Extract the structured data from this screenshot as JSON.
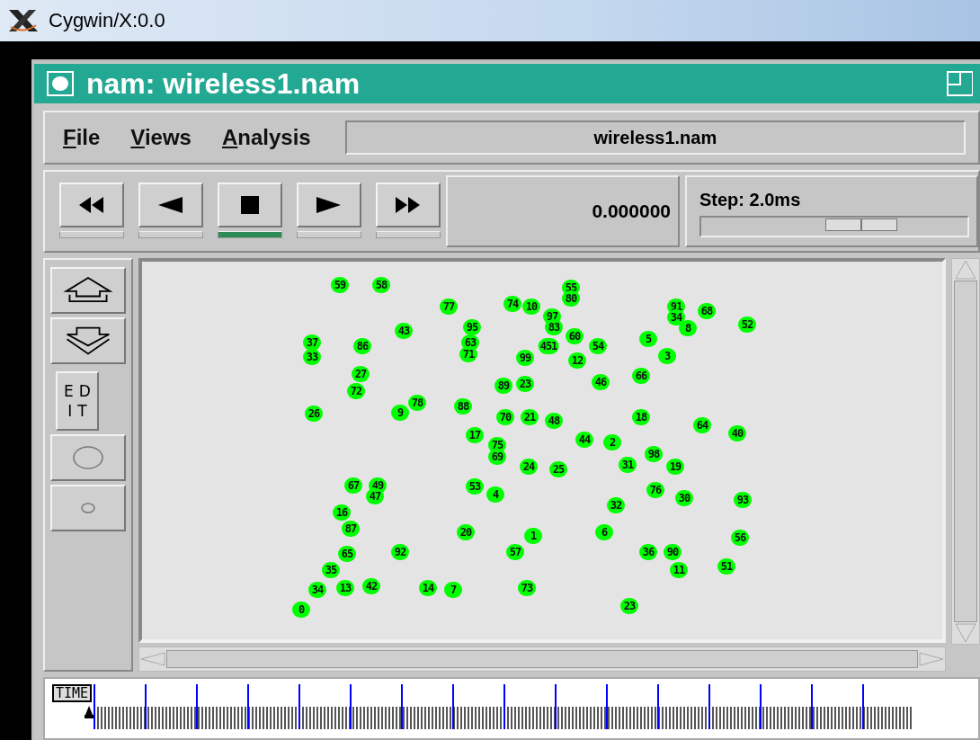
{
  "screen_title": "Cygwin/X:0.0",
  "window": {
    "title": "nam: wireless1.nam"
  },
  "menu": [
    {
      "label": "File"
    },
    {
      "label": "Views"
    },
    {
      "label": "Analysis"
    }
  ],
  "file_field": {
    "value": "wireless1.nam"
  },
  "playback_buttons": [
    {
      "kind": "rewind",
      "selected": false
    },
    {
      "kind": "back",
      "selected": false
    },
    {
      "kind": "stop",
      "selected": true
    },
    {
      "kind": "play",
      "selected": false
    },
    {
      "kind": "forward",
      "selected": false
    }
  ],
  "time": "0.000000",
  "step": {
    "label": "Step: 2.0ms",
    "level": 0.6
  },
  "tools": [
    {
      "kind": "zoom-in"
    },
    {
      "kind": "zoom-out"
    },
    {
      "kind": "edit",
      "label": "EDIT"
    },
    {
      "kind": "large-circle"
    },
    {
      "kind": "small-circle"
    }
  ],
  "nodes": [
    {
      "label": "59"
    },
    {
      "label": "58"
    },
    {
      "label": "55"
    },
    {
      "label": "77"
    },
    {
      "label": "74"
    },
    {
      "label": "10"
    },
    {
      "label": "80"
    },
    {
      "label": "91"
    },
    {
      "label": "68"
    },
    {
      "label": "43"
    },
    {
      "label": "95"
    },
    {
      "label": "97"
    },
    {
      "label": "83"
    },
    {
      "label": "34"
    },
    {
      "label": "8"
    },
    {
      "label": "52"
    },
    {
      "label": "37"
    },
    {
      "label": "86"
    },
    {
      "label": "63"
    },
    {
      "label": "451"
    },
    {
      "label": "60"
    },
    {
      "label": "54"
    },
    {
      "label": "5"
    },
    {
      "label": "33"
    },
    {
      "label": "71"
    },
    {
      "label": "99"
    },
    {
      "label": "12"
    },
    {
      "label": "3"
    },
    {
      "label": "27"
    },
    {
      "label": "72"
    },
    {
      "label": "89"
    },
    {
      "label": "23"
    },
    {
      "label": "46"
    },
    {
      "label": "66"
    },
    {
      "label": "26"
    },
    {
      "label": "9"
    },
    {
      "label": "78"
    },
    {
      "label": "88"
    },
    {
      "label": "70"
    },
    {
      "label": "21"
    },
    {
      "label": "48"
    },
    {
      "label": "18"
    },
    {
      "label": "17"
    },
    {
      "label": "75"
    },
    {
      "label": "44"
    },
    {
      "label": "2"
    },
    {
      "label": "64"
    },
    {
      "label": "40"
    },
    {
      "label": "69"
    },
    {
      "label": "24"
    },
    {
      "label": "25"
    },
    {
      "label": "31"
    },
    {
      "label": "98"
    },
    {
      "label": "19"
    },
    {
      "label": "67"
    },
    {
      "label": "49"
    },
    {
      "label": "47"
    },
    {
      "label": "16"
    },
    {
      "label": "53"
    },
    {
      "label": "4"
    },
    {
      "label": "32"
    },
    {
      "label": "76"
    },
    {
      "label": "30"
    },
    {
      "label": "93"
    },
    {
      "label": "87"
    },
    {
      "label": "20"
    },
    {
      "label": "1"
    },
    {
      "label": "6"
    },
    {
      "label": "56"
    },
    {
      "label": "65"
    },
    {
      "label": "92"
    },
    {
      "label": "57"
    },
    {
      "label": "36"
    },
    {
      "label": "90"
    },
    {
      "label": "35"
    },
    {
      "label": "11"
    },
    {
      "label": "51"
    },
    {
      "label": "34"
    },
    {
      "label": "13"
    },
    {
      "label": "42"
    },
    {
      "label": "14"
    },
    {
      "label": "7"
    },
    {
      "label": "73"
    },
    {
      "label": "0"
    },
    {
      "label": "23"
    }
  ],
  "timeline": {
    "label": "TIME"
  }
}
